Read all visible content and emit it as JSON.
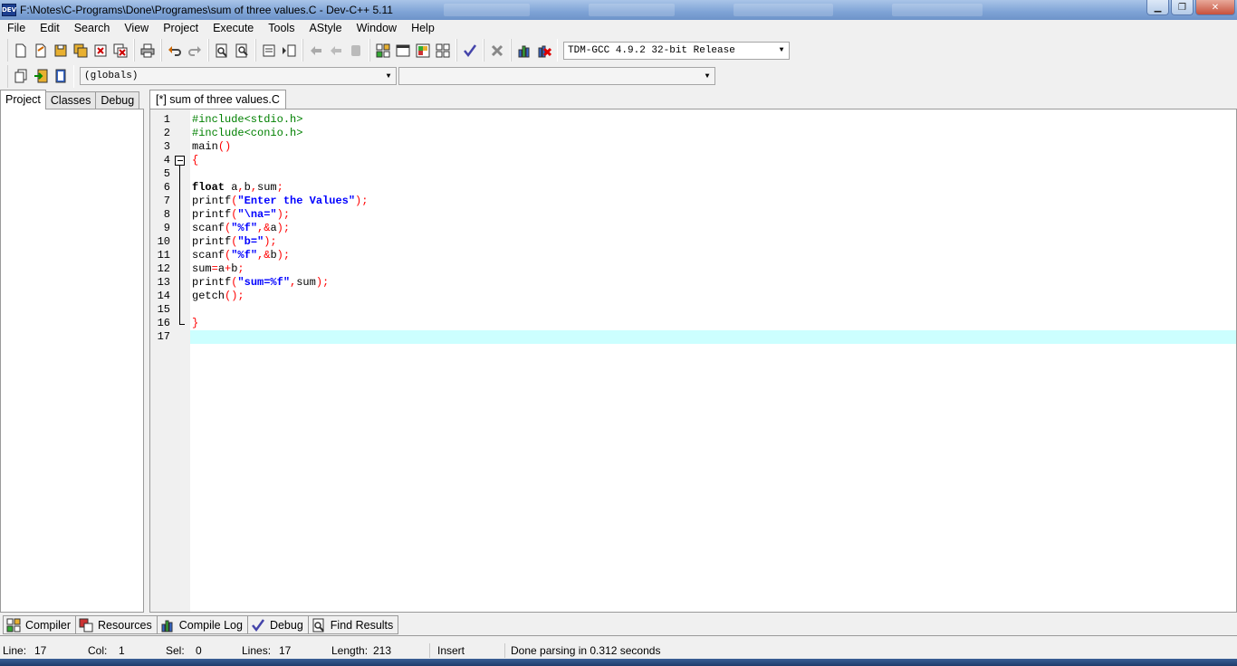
{
  "window": {
    "title": "F:\\Notes\\C-Programs\\Done\\Programes\\sum of three values.C - Dev-C++ 5.11",
    "icon_label": "DEV",
    "controls": {
      "minimize": "▁",
      "maximize": "❐",
      "close": "✕"
    }
  },
  "menu": [
    "File",
    "Edit",
    "Search",
    "View",
    "Project",
    "Execute",
    "Tools",
    "AStyle",
    "Window",
    "Help"
  ],
  "toolbar": {
    "compiler_select": "TDM-GCC 4.9.2 32-bit Release",
    "scope_select": "(globals)",
    "member_select": ""
  },
  "left_panel": {
    "tabs": [
      "Project",
      "Classes",
      "Debug"
    ],
    "active_tab": "Project"
  },
  "editor": {
    "tab_label": "[*] sum of three values.C",
    "current_line": 17,
    "lines": [
      {
        "n": "1",
        "tokens": [
          {
            "t": "#include<stdio.h>",
            "c": "pre"
          }
        ]
      },
      {
        "n": "2",
        "tokens": [
          {
            "t": "#include<conio.h>",
            "c": "pre"
          }
        ]
      },
      {
        "n": "3",
        "tokens": [
          {
            "t": "main",
            "c": "id"
          },
          {
            "t": "()",
            "c": "sym"
          }
        ]
      },
      {
        "n": "4",
        "tokens": [
          {
            "t": "{",
            "c": "sym"
          }
        ]
      },
      {
        "n": "5",
        "tokens": []
      },
      {
        "n": "6",
        "tokens": [
          {
            "t": "float",
            "c": "kw"
          },
          {
            "t": " a",
            "c": "id"
          },
          {
            "t": ",",
            "c": "sym"
          },
          {
            "t": "b",
            "c": "id"
          },
          {
            "t": ",",
            "c": "sym"
          },
          {
            "t": "sum",
            "c": "id"
          },
          {
            "t": ";",
            "c": "sym"
          }
        ]
      },
      {
        "n": "7",
        "tokens": [
          {
            "t": "printf",
            "c": "id"
          },
          {
            "t": "(",
            "c": "sym"
          },
          {
            "t": "\"Enter the Values\"",
            "c": "str"
          },
          {
            "t": ");",
            "c": "sym"
          }
        ]
      },
      {
        "n": "8",
        "tokens": [
          {
            "t": "printf",
            "c": "id"
          },
          {
            "t": "(",
            "c": "sym"
          },
          {
            "t": "\"\\na=\"",
            "c": "str"
          },
          {
            "t": ");",
            "c": "sym"
          }
        ]
      },
      {
        "n": "9",
        "tokens": [
          {
            "t": "scanf",
            "c": "id"
          },
          {
            "t": "(",
            "c": "sym"
          },
          {
            "t": "\"%f\"",
            "c": "str"
          },
          {
            "t": ",&",
            "c": "sym"
          },
          {
            "t": "a",
            "c": "id"
          },
          {
            "t": ");",
            "c": "sym"
          }
        ]
      },
      {
        "n": "10",
        "tokens": [
          {
            "t": "printf",
            "c": "id"
          },
          {
            "t": "(",
            "c": "sym"
          },
          {
            "t": "\"b=\"",
            "c": "str"
          },
          {
            "t": ");",
            "c": "sym"
          }
        ]
      },
      {
        "n": "11",
        "tokens": [
          {
            "t": "scanf",
            "c": "id"
          },
          {
            "t": "(",
            "c": "sym"
          },
          {
            "t": "\"%f\"",
            "c": "str"
          },
          {
            "t": ",&",
            "c": "sym"
          },
          {
            "t": "b",
            "c": "id"
          },
          {
            "t": ");",
            "c": "sym"
          }
        ]
      },
      {
        "n": "12",
        "tokens": [
          {
            "t": "sum",
            "c": "id"
          },
          {
            "t": "=",
            "c": "sym"
          },
          {
            "t": "a",
            "c": "id"
          },
          {
            "t": "+",
            "c": "sym"
          },
          {
            "t": "b",
            "c": "id"
          },
          {
            "t": ";",
            "c": "sym"
          }
        ]
      },
      {
        "n": "13",
        "tokens": [
          {
            "t": "printf",
            "c": "id"
          },
          {
            "t": "(",
            "c": "sym"
          },
          {
            "t": "\"sum=%f\"",
            "c": "str"
          },
          {
            "t": ",",
            "c": "sym"
          },
          {
            "t": "sum",
            "c": "id"
          },
          {
            "t": ");",
            "c": "sym"
          }
        ]
      },
      {
        "n": "14",
        "tokens": [
          {
            "t": "getch",
            "c": "id"
          },
          {
            "t": "();",
            "c": "sym"
          }
        ]
      },
      {
        "n": "15",
        "tokens": []
      },
      {
        "n": "16",
        "tokens": [
          {
            "t": "}",
            "c": "sym"
          }
        ]
      },
      {
        "n": "17",
        "tokens": []
      }
    ]
  },
  "bottom_tabs": [
    {
      "label": "Compiler",
      "icon": "grid-icon"
    },
    {
      "label": "Resources",
      "icon": "resources-icon"
    },
    {
      "label": "Compile Log",
      "icon": "bar-chart-icon"
    },
    {
      "label": "Debug",
      "icon": "check-icon"
    },
    {
      "label": "Find Results",
      "icon": "find-icon"
    }
  ],
  "status": {
    "line_label": "Line:",
    "line_value": "17",
    "col_label": "Col:",
    "col_value": "1",
    "sel_label": "Sel:",
    "sel_value": "0",
    "lines_label": "Lines:",
    "lines_value": "17",
    "length_label": "Length:",
    "length_value": "213",
    "mode": "Insert",
    "message": "Done parsing in 0.312 seconds"
  },
  "colors": {
    "preprocessor": "#008000",
    "string": "#0000ff",
    "symbol": "#ff0000",
    "current_line_highlight": "#ccffff"
  }
}
